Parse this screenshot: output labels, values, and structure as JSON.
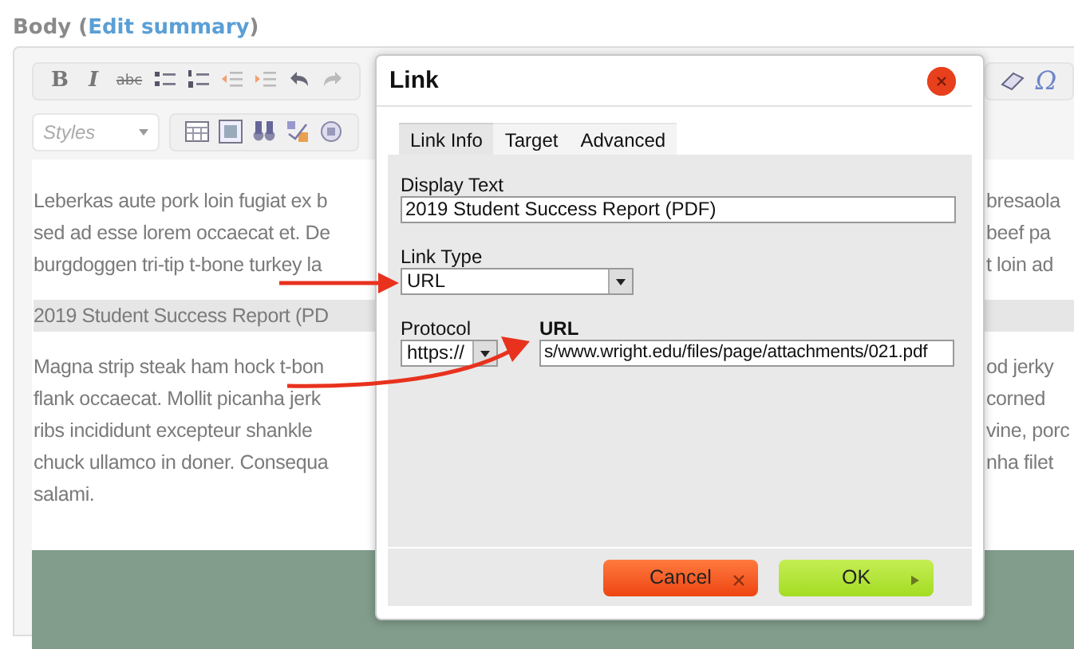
{
  "heading": {
    "label": "Body (",
    "link": "Edit summary",
    "suffix": ")"
  },
  "toolbar_row_1": [
    {
      "kind": "text",
      "label": "B"
    },
    {
      "kind": "text",
      "label": "I"
    },
    {
      "kind": "text",
      "label": "abc"
    },
    {
      "kind": "bullets"
    },
    {
      "kind": "numbers"
    },
    {
      "kind": "outdent"
    },
    {
      "kind": "indent"
    },
    {
      "kind": "undo"
    },
    {
      "kind": "redo"
    }
  ],
  "toolbar_row_1_right": [
    {
      "kind": "eraser"
    },
    {
      "kind": "text",
      "label": "Ω"
    }
  ],
  "styles_dropdown": {
    "placeholder": "Styles"
  },
  "toolbar_row_2": [
    {
      "kind": "table"
    },
    {
      "kind": "frame"
    },
    {
      "kind": "binoculars"
    },
    {
      "kind": "spellcheck"
    },
    {
      "kind": "target"
    }
  ],
  "content": [
    {
      "kind": "paragraph",
      "lines": [
        {
          "left": "Leberkas aute pork loin fugiat ex b",
          "right": "bresaola"
        },
        {
          "left": "sed ad esse lorem occaecat et. De",
          "right": "beef pa"
        },
        {
          "left": "burgdoggen tri-tip t-bone turkey la",
          "right": "t loin ad"
        }
      ]
    },
    {
      "kind": "link",
      "lines": [
        {
          "left": "2019 Student Success Report (PD"
        }
      ]
    },
    {
      "kind": "paragraph",
      "lines": [
        {
          "left": "Magna strip steak ham hock t-bon",
          "right": "od jerky"
        },
        {
          "left": "flank occaecat. Mollit picanha jerk",
          "right": "corned"
        },
        {
          "left": "ribs incididunt excepteur shankle",
          "right": "vine, porc"
        },
        {
          "left": "chuck ullamco in doner. Consequa",
          "right": "nha filet"
        },
        {
          "left": "salami."
        }
      ]
    }
  ],
  "dialog": {
    "title": "Link",
    "tabs": [
      {
        "label": "Link Info",
        "selected": true
      },
      {
        "label": "Target",
        "selected": false
      },
      {
        "label": "Advanced",
        "selected": false
      }
    ],
    "display_text": {
      "label": "Display Text",
      "value": "2019 Student Success Report (PDF)"
    },
    "link_type": {
      "label": "Link Type",
      "value": "URL"
    },
    "protocol": {
      "label": "Protocol",
      "value": "https://"
    },
    "url": {
      "label": "URL",
      "value": "s/www.wright.edu/files/page/attachments/021.pdf"
    },
    "buttons": [
      {
        "kind": "cancel",
        "label": "Cancel"
      },
      {
        "kind": "ok",
        "label": "OK"
      }
    ]
  }
}
